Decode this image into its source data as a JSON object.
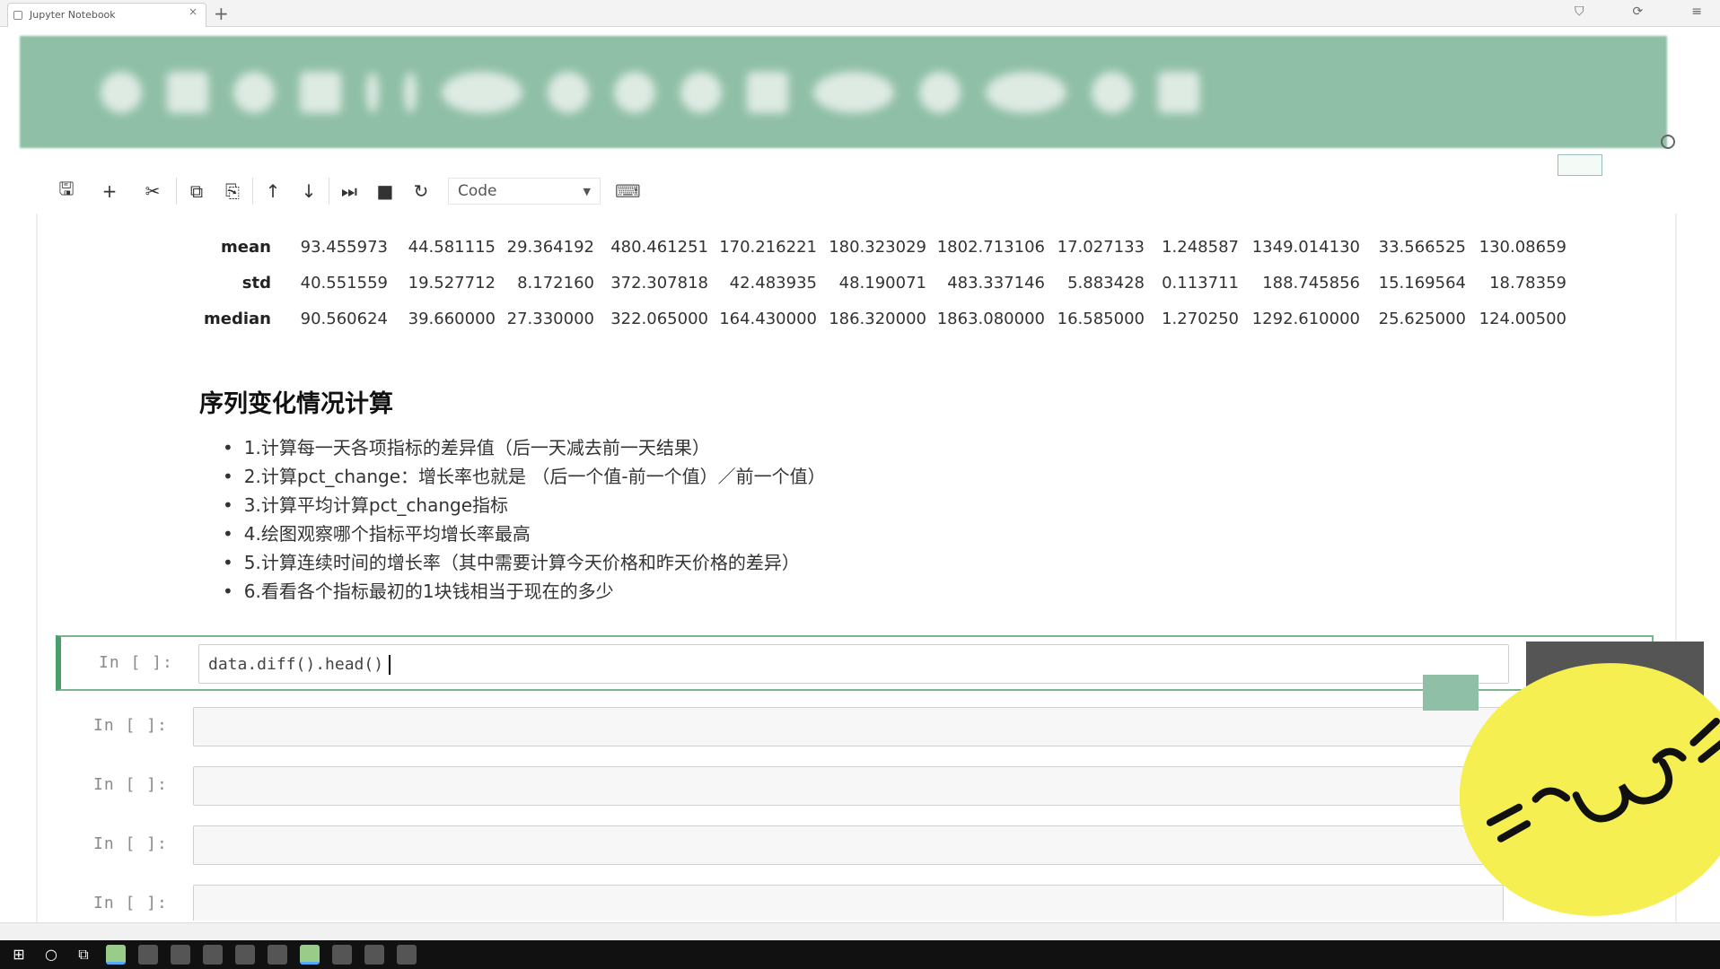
{
  "browser": {
    "tab_title": "Jupyter Notebook",
    "close_glyph": "×",
    "new_tab_glyph": "+",
    "window_controls": [
      "⛉",
      "⟳",
      "≡"
    ]
  },
  "toolbar": {
    "buttons": [
      {
        "name": "save-icon",
        "glyph": "🖫"
      },
      {
        "name": "insert-cell-icon",
        "glyph": "+"
      },
      {
        "name": "cut-icon",
        "glyph": "✂"
      },
      {
        "name": "copy-icon",
        "glyph": "⧉"
      },
      {
        "name": "paste-icon",
        "glyph": "⎘"
      },
      {
        "name": "move-up-icon",
        "glyph": "↑"
      },
      {
        "name": "move-down-icon",
        "glyph": "↓"
      },
      {
        "name": "run-icon",
        "glyph": "⏭"
      },
      {
        "name": "stop-icon",
        "glyph": "■"
      },
      {
        "name": "restart-icon",
        "glyph": "↻"
      }
    ],
    "cell_type": "Code",
    "cell_type_caret": "▼",
    "keyboard_glyph": "⌨"
  },
  "stats_table": {
    "rows": [
      {
        "label": "mean",
        "values": [
          "93.455973",
          "44.581115",
          "29.364192",
          "480.461251",
          "170.216221",
          "180.323029",
          "1802.713106",
          "17.027133",
          "1.248587",
          "1349.014130",
          "33.566525",
          "130.08659"
        ]
      },
      {
        "label": "std",
        "values": [
          "40.551559",
          "19.527712",
          "8.172160",
          "372.307818",
          "42.483935",
          "48.190071",
          "483.337146",
          "5.883428",
          "0.113711",
          "188.745856",
          "15.169564",
          "18.78359"
        ]
      },
      {
        "label": "median",
        "values": [
          "90.560624",
          "39.660000",
          "27.330000",
          "322.065000",
          "164.430000",
          "186.320000",
          "1863.080000",
          "16.585000",
          "1.270250",
          "1292.610000",
          "25.625000",
          "124.00500"
        ]
      }
    ]
  },
  "markdown": {
    "title": "序列变化情况计算",
    "items": [
      "1.计算每一天各项指标的差异值（后一天减去前一天结果）",
      "2.计算pct_change：增长率也就是 （后一个值-前一个值）／前一个值）",
      "3.计算平均计算pct_change指标",
      "4.绘图观察哪个指标平均增长率最高",
      "5.计算连续时间的增长率（其中需要计算今天价格和昨天价格的差异）",
      "6.看看各个指标最初的1块钱相当于现在的多少"
    ]
  },
  "cells": [
    {
      "prompt": "In [ ]:",
      "code": "data.diff().head()"
    },
    {
      "prompt": "In [ ]:",
      "code": ""
    },
    {
      "prompt": "In [ ]:",
      "code": ""
    },
    {
      "prompt": "In [ ]:",
      "code": ""
    },
    {
      "prompt": "In [ ]:",
      "code": ""
    }
  ],
  "statusbar": {
    "left": "",
    "right": ""
  },
  "colors": {
    "banner": "#8fbfa6",
    "active_cell_border": "#47a06a",
    "sticker": "#f6ef52"
  }
}
